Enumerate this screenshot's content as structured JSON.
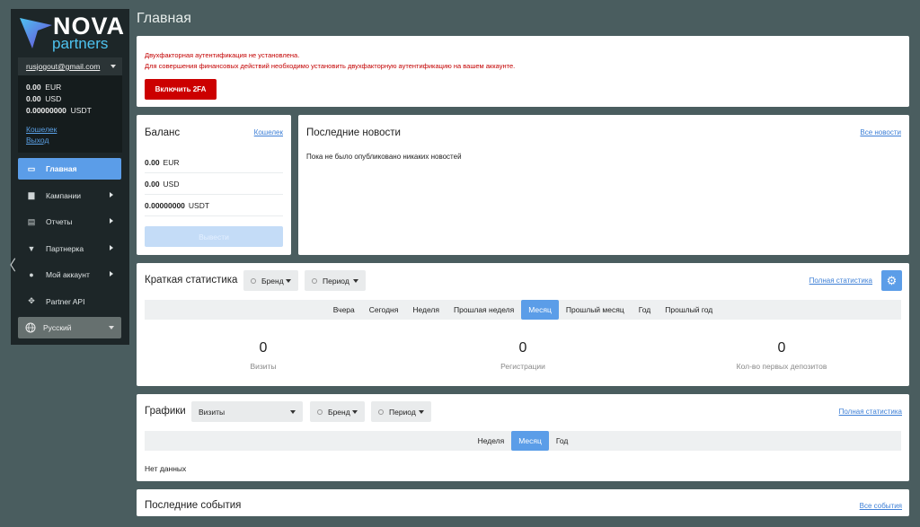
{
  "sidebar": {
    "logo_nova": "NOVA",
    "logo_partners": "partners",
    "email": "rusjogout@gmail.com",
    "balances": [
      {
        "amount": "0.00",
        "currency": "EUR"
      },
      {
        "amount": "0.00",
        "currency": "USD"
      },
      {
        "amount": "0.00000000",
        "currency": "USDT"
      }
    ],
    "wallet_link": "Кошелек",
    "logout_link": "Выход",
    "menu": [
      {
        "label": "Главная",
        "icon": "card-icon",
        "glyph": "▭",
        "active": true,
        "arrow": false
      },
      {
        "label": "Кампании",
        "icon": "briefcase-icon",
        "glyph": "▆",
        "active": false,
        "arrow": true
      },
      {
        "label": "Отчеты",
        "icon": "report-icon",
        "glyph": "▤",
        "active": false,
        "arrow": true
      },
      {
        "label": "Партнерка",
        "icon": "diamond-icon",
        "glyph": "▼",
        "active": false,
        "arrow": true
      },
      {
        "label": "Мой аккаунт",
        "icon": "user-icon",
        "glyph": "●",
        "active": false,
        "arrow": true
      },
      {
        "label": "Partner API",
        "icon": "arrows-icon",
        "glyph": "✥",
        "active": false,
        "arrow": false
      }
    ],
    "language": "Русский"
  },
  "main": {
    "title": "Главная",
    "alert": {
      "line1": "Двухфакторная аутентификация не установлена.",
      "line2": "Для совершения финансовых действий необходимо установить двухфакторную аутентификацию на вашем аккаунте.",
      "button": "Включить 2FA"
    },
    "balance": {
      "title": "Баланс",
      "link": "Кошелек",
      "rows": [
        {
          "amount": "0.00",
          "currency": "EUR"
        },
        {
          "amount": "0.00",
          "currency": "USD"
        },
        {
          "amount": "0.00000000",
          "currency": "USDT"
        }
      ],
      "withdraw": "Вывести"
    },
    "news": {
      "title": "Последние новости",
      "link": "Все новости",
      "empty": "Пока не было опубликовано никаких новостей"
    },
    "quick_stats": {
      "title": "Краткая статистика",
      "brand": "Бренд",
      "period": "Период",
      "link": "Полная статистика",
      "tabs": [
        "Вчера",
        "Сегодня",
        "Неделя",
        "Прошлая неделя",
        "Месяц",
        "Прошлый месяц",
        "Год",
        "Прошлый год"
      ],
      "active_tab": "Месяц",
      "stats": [
        {
          "value": "0",
          "label": "Визиты"
        },
        {
          "value": "0",
          "label": "Регистрации"
        },
        {
          "value": "0",
          "label": "Кол-во первых депозитов"
        }
      ]
    },
    "charts": {
      "title": "Графики",
      "metric": "Визиты",
      "brand": "Бренд",
      "period": "Период",
      "link": "Полная статистика",
      "tabs": [
        "Неделя",
        "Месяц",
        "Год"
      ],
      "active_tab": "Месяц",
      "empty": "Нет данных"
    },
    "events": {
      "title": "Последние события",
      "link": "Все события"
    }
  },
  "colors": {
    "accent": "#5b9de8",
    "danger": "#cc0000",
    "background": "#4a5d5f",
    "sidebar": "#1d2628"
  }
}
